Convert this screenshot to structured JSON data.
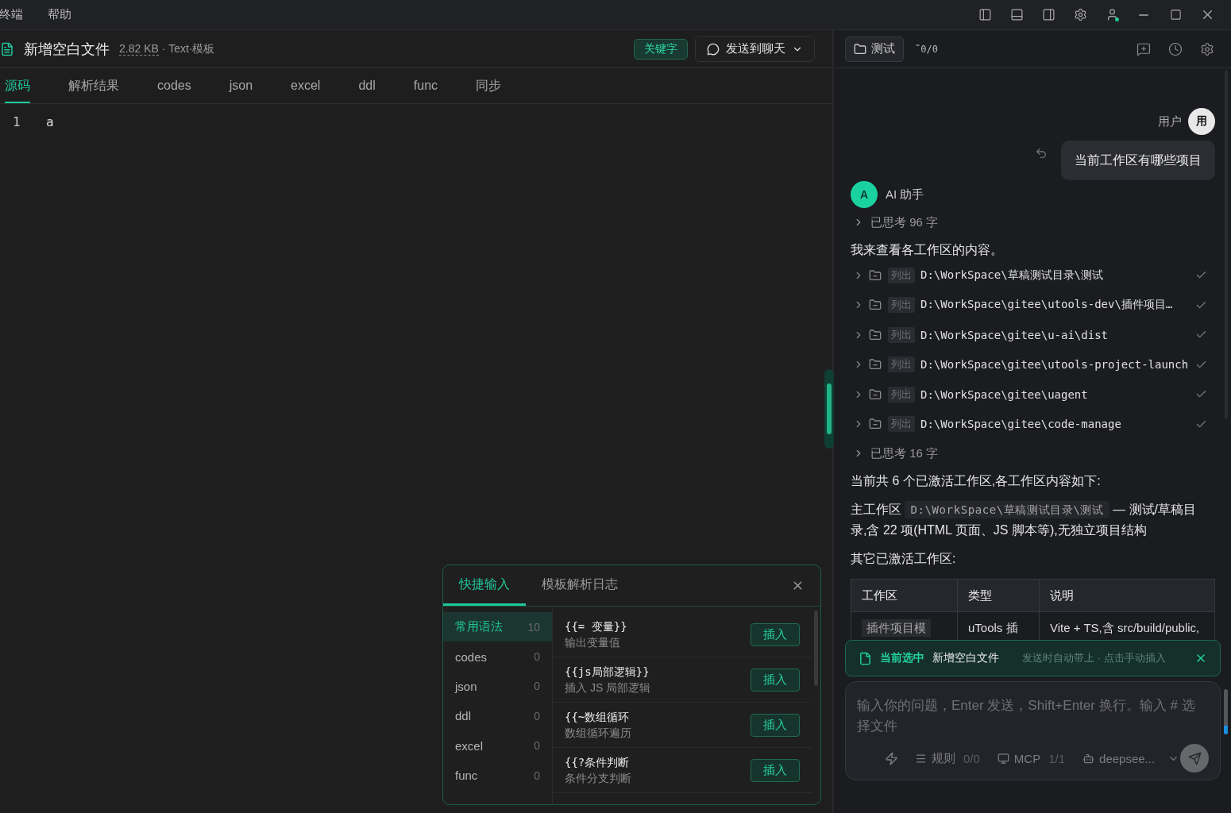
{
  "menu_bar": {
    "items": [
      "终端",
      "帮助"
    ]
  },
  "file_header": {
    "title": "新增空白文件",
    "size": "2.82 KB",
    "meta": "· Text·模板",
    "keyword_button": "关键字",
    "send_button": "发送到聊天"
  },
  "tabs": [
    {
      "label": "源码",
      "selected": true
    },
    {
      "label": "解析结果",
      "selected": false
    },
    {
      "label": "codes",
      "selected": false
    },
    {
      "label": "json",
      "selected": false
    },
    {
      "label": "excel",
      "selected": false
    },
    {
      "label": "ddl",
      "selected": false
    },
    {
      "label": "func",
      "selected": false
    },
    {
      "label": "同步",
      "selected": false
    }
  ],
  "editor": {
    "lines": [
      {
        "number": "1",
        "text": "a"
      }
    ]
  },
  "quick_panel": {
    "tabs": [
      {
        "label": "快捷输入",
        "selected": true
      },
      {
        "label": "模板解析日志",
        "selected": false
      }
    ],
    "categories": [
      {
        "label": "常用语法",
        "count": "10",
        "selected": true
      },
      {
        "label": "codes",
        "count": "0",
        "selected": false
      },
      {
        "label": "json",
        "count": "0",
        "selected": false
      },
      {
        "label": "ddl",
        "count": "0",
        "selected": false
      },
      {
        "label": "excel",
        "count": "0",
        "selected": false
      },
      {
        "label": "func",
        "count": "0",
        "selected": false
      }
    ],
    "snippets": [
      {
        "syntax": "{{= 变量}}",
        "description": "输出变量值",
        "action": "插入"
      },
      {
        "syntax": "{{js局部逻辑}}",
        "description": "插入 JS 局部逻辑",
        "action": "插入"
      },
      {
        "syntax": "{{~数组循环",
        "description": "数组循环遍历",
        "action": "插入"
      },
      {
        "syntax": "{{?条件判断",
        "description": "条件分支判断",
        "action": "插入"
      }
    ]
  },
  "chat_header": {
    "workspace_button": "测试",
    "sync_status": "˜0/0"
  },
  "user_message": {
    "name": "用户",
    "avatar": "用",
    "text": "当前工作区有哪些项目"
  },
  "assistant": {
    "avatar": "A",
    "name": "AI 助手",
    "blocks": [
      {
        "kind": "thinking",
        "text": "已思考 96 字"
      },
      {
        "kind": "paragraph",
        "text": "我来查看各工作区的内容。"
      },
      {
        "kind": "tool",
        "badge": "列出",
        "path": "D:\\WorkSpace\\草稿测试目录\\测试",
        "done": true
      },
      {
        "kind": "tool",
        "badge": "列出",
        "path": "D:\\WorkSpace\\gitee\\utools-dev\\插件项目…",
        "done": true
      },
      {
        "kind": "tool",
        "badge": "列出",
        "path": "D:\\WorkSpace\\gitee\\u-ai\\dist",
        "done": true
      },
      {
        "kind": "tool",
        "badge": "列出",
        "path": "D:\\WorkSpace\\gitee\\utools-project-launch",
        "done": true
      },
      {
        "kind": "tool",
        "badge": "列出",
        "path": "D:\\WorkSpace\\gitee\\uagent",
        "done": true
      },
      {
        "kind": "tool",
        "badge": "列出",
        "path": "D:\\WorkSpace\\gitee\\code-manage",
        "done": true
      },
      {
        "kind": "thinking",
        "text": "已思考 16 字"
      },
      {
        "kind": "paragraph",
        "text": "当前共 6 个已激活工作区,各工作区内容如下:"
      },
      {
        "kind": "code_paragraph",
        "lead": "主工作区",
        "code": "D:\\WorkSpace\\草稿测试目录\\测试",
        "rest": "— 测试/草稿目录,含 22 项(HTML 页面、JS 脚本等),无独立项目结构"
      },
      {
        "kind": "paragraph",
        "text": "其它已激活工作区:"
      },
      {
        "kind": "table",
        "columns": [
          "工作区",
          "类型",
          "说明"
        ],
        "rows": [
          [
            {
              "kind": "code",
              "text": "插件项目模"
            },
            {
              "kind": "text",
              "text": "uTools 插"
            },
            {
              "kind": "text",
              "text": "Vite + TS,含 src/build/public,"
            }
          ]
        ]
      }
    ]
  },
  "selection_banner": {
    "label": "当前选中",
    "file": "新增空白文件",
    "hint": "发送时自动带上 · 点击手动插入"
  },
  "composer": {
    "placeholder": "输入你的问题，Enter 发送，Shift+Enter 换行。输入 # 选择文件",
    "rules_label": "规则",
    "rules_count": "0/0",
    "mcp_label": "MCP",
    "mcp_count": "1/1",
    "model": "deepsee..."
  }
}
